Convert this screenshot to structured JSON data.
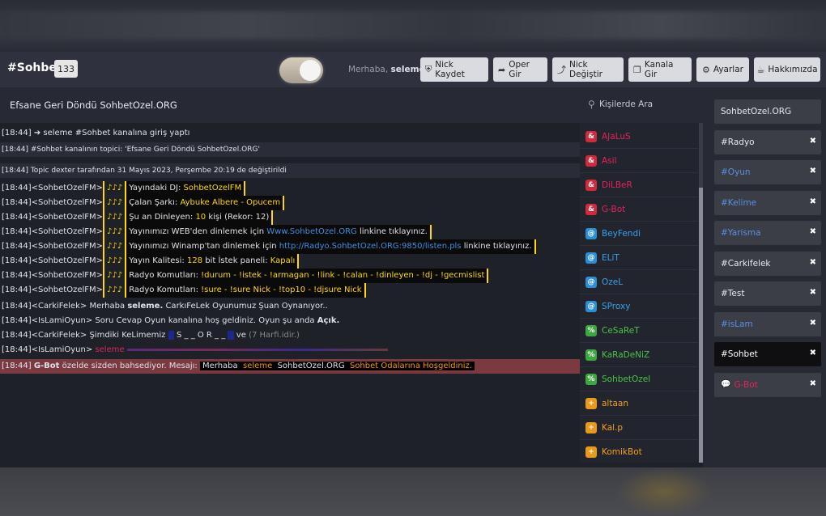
{
  "header": {
    "channel": "#Sohbet",
    "user_count": "133",
    "greeting_prefix": "Merhaba,",
    "greeting_user": "seleme",
    "buttons": [
      {
        "label": "Nick Kaydet",
        "icon": "shield-icon"
      },
      {
        "label": "Oper Gir",
        "icon": "share-icon"
      },
      {
        "label": "Nick Değiştir",
        "icon": "external-link-icon"
      },
      {
        "label": "Kanala Gir",
        "icon": "copy-icon"
      },
      {
        "label": "Ayarlar",
        "icon": "gear-icon"
      },
      {
        "label": "Hakkımızda",
        "icon": "coffee-icon"
      }
    ]
  },
  "topic": "Efsane Geri Döndü SohbetOzel.ORG",
  "search": {
    "placeholder": "Kişilerde Ara"
  },
  "chat": {
    "l1": {
      "ts": "[18:44]",
      "text": "➔ seleme #Sohbet kanalına giriş yaptı"
    },
    "l2": {
      "ts": "[18:44]",
      "text": "#Sohbet kanalının topici: 'Efsane Geri Döndü SohbetOzel.ORG'"
    },
    "l3": {
      "ts": "[18:44]",
      "text": "Topic dexter tarafından 31 Mayıs 2023, Perşembe 20:19 de değiştirildi"
    },
    "l4": {
      "ts": "[18:44]",
      "nick": "<SohbetOzelFM>",
      "tag": "♪♪♪",
      "label": "Yayındaki DJ:",
      "value": "SohbetOzelFM"
    },
    "l5": {
      "ts": "[18:44]",
      "nick": "<SohbetOzelFM>",
      "tag": "♪♪♪",
      "label": "Çalan Şarkı:",
      "value": "Aybuke Albere - Opucem"
    },
    "l6": {
      "ts": "[18:44]",
      "nick": "<SohbetOzelFM>",
      "tag": "♪♪♪",
      "label": "Şu an Dinleyen:",
      "value": "10",
      "suffix": "kişi (Rekor: 12)"
    },
    "l7": {
      "ts": "[18:44]",
      "nick": "<SohbetOzelFM>",
      "tag": "♪♪♪",
      "label": "Yayınımızı WEB'den dinlemek için",
      "link": "Www.SohbetOzel.ORG",
      "suffix": "linkine tıklayınız."
    },
    "l8": {
      "ts": "[18:44]",
      "nick": "<SohbetOzelFM>",
      "tag": "♪♪♪",
      "label": "Yayınımızı Winamp'tan dinlemek için",
      "link": "http://Radyo.SohbetOzel.ORG:9850/listen.pls",
      "suffix": "linkine tıklayınız."
    },
    "l9": {
      "ts": "[18:44]",
      "nick": "<SohbetOzelFM>",
      "tag": "♪♪♪",
      "label": "Yayın Kalitesi:",
      "value": "128",
      "mid": "bit İstek paneli:",
      "value2": "Kapalı"
    },
    "l10": {
      "ts": "[18:44]",
      "nick": "<SohbetOzelFM>",
      "tag": "♪♪♪",
      "label": "Radyo Komutları:",
      "value": "!durum - !istek - !armagan - !link - !calan - !dinleyen - !dj - !gecmislist"
    },
    "l11": {
      "ts": "[18:44]",
      "nick": "<SohbetOzelFM>",
      "tag": "♪♪♪",
      "label": "Radyo Komutları:",
      "value": "!sure - !sure Nick - !top10 - !djsure Nick"
    },
    "l12": {
      "ts": "[18:44]",
      "nick": "<CarkiFelek>",
      "text": "Merhaba",
      "user": "seleme.",
      "rest": "CarkıFeLek Oyunumuz Şuan Oynanıyor.."
    },
    "l13": {
      "ts": "[18:44]",
      "nick": "<IsLamiOyun>",
      "text": "Soru Cevap Oyun kanalına hoş geldiniz. Oyun şu anda",
      "bold": "Açık."
    },
    "l14": {
      "ts": "[18:44]",
      "nick": "<CarkiFelek>",
      "text": "Şimdiki KeLimemiz",
      "word": "S _ _ O R _ _",
      "rest": "ve",
      "hint": "(7 Harfi.idir.)"
    },
    "l15": {
      "ts": "[18:44]",
      "nick": "<IsLamiOyun>",
      "user": "seleme"
    },
    "l16": {
      "ts": "[18:44]",
      "nick": "G-Bot",
      "text": "özelde sizden bahsediyor. Mesajı:",
      "m1": "Merhaba",
      "m2": "seleme",
      "m3": "SohbetOzel.ORG",
      "m4": "Sohbet Odalarına Hoşgeldiniz."
    }
  },
  "users": [
    {
      "prefix": "&",
      "name": "AJaLuS",
      "color": "#e0245a",
      "badge": "#d12a3a"
    },
    {
      "prefix": "&",
      "name": "Asil",
      "color": "#e0245a",
      "badge": "#d12a3a"
    },
    {
      "prefix": "&",
      "name": "DiLBeR",
      "color": "#e0245a",
      "badge": "#d12a3a"
    },
    {
      "prefix": "&",
      "name": "G-Bot",
      "color": "#e0245a",
      "badge": "#d12a3a"
    },
    {
      "prefix": "@",
      "name": "BeyFendi",
      "color": "#3aa0e8",
      "badge": "#2b8fd6"
    },
    {
      "prefix": "@",
      "name": "ELiT",
      "color": "#3aa0e8",
      "badge": "#2b8fd6"
    },
    {
      "prefix": "@",
      "name": "OzeL",
      "color": "#3aa0e8",
      "badge": "#2b8fd6"
    },
    {
      "prefix": "@",
      "name": "SProxy",
      "color": "#3aa0e8",
      "badge": "#2b8fd6"
    },
    {
      "prefix": "%",
      "name": "CeSaReT",
      "color": "#4cc14c",
      "badge": "#3da83d"
    },
    {
      "prefix": "%",
      "name": "KaRaDeNiZ",
      "color": "#4cc14c",
      "badge": "#3da83d"
    },
    {
      "prefix": "%",
      "name": "SohbetOzel",
      "color": "#4cc14c",
      "badge": "#3da83d"
    },
    {
      "prefix": "+",
      "name": "altaan",
      "color": "#f0a020",
      "badge": "#e89a18"
    },
    {
      "prefix": "+",
      "name": "Kal.p",
      "color": "#f0a020",
      "badge": "#e89a18"
    },
    {
      "prefix": "+",
      "name": "KomikBot",
      "color": "#f0a020",
      "badge": "#e89a18"
    }
  ],
  "channels": [
    {
      "name": "SohbetOzel.ORG",
      "closable": false,
      "color": "#e8e8ee"
    },
    {
      "name": "#Radyo",
      "closable": true,
      "color": "#e8e8ee"
    },
    {
      "name": "#Oyun",
      "closable": true,
      "color": "#5b8fe0"
    },
    {
      "name": "#Kelime",
      "closable": true,
      "color": "#5b8fe0"
    },
    {
      "name": "#Yarisma",
      "closable": true,
      "color": "#5b8fe0"
    },
    {
      "name": "#Carkifelek",
      "closable": true,
      "color": "#e8e8ee"
    },
    {
      "name": "#Test",
      "closable": true,
      "color": "#e8e8ee"
    },
    {
      "name": "#isLam",
      "closable": true,
      "color": "#5b8fe0"
    },
    {
      "name": "#Sohbet",
      "closable": true,
      "color": "#ffffff",
      "active": true
    },
    {
      "name": "G-Bot",
      "closable": true,
      "color": "#e0245a",
      "private": true
    }
  ],
  "close_glyph": "✖"
}
